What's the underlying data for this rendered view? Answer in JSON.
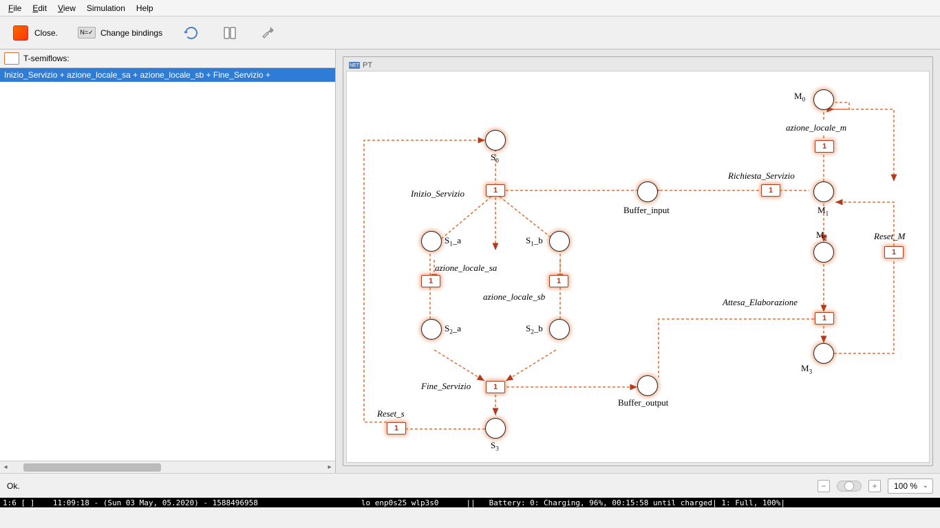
{
  "menubar": {
    "file": "File",
    "edit": "Edit",
    "view": "View",
    "simulation": "Simulation",
    "help": "Help"
  },
  "toolbar": {
    "close": "Close.",
    "change_bindings": "Change bindings"
  },
  "sidebar": {
    "title": "T-semiflows:",
    "item0": "Inizio_Servizio + azione_locale_sa + azione_locale_sb + Fine_Servizio +"
  },
  "canvas": {
    "title": "PT",
    "net_icon": "NET"
  },
  "net": {
    "t_val": "1",
    "places": {
      "S0": "S₀",
      "S1a": "S₁_a",
      "S1b": "S₁_b",
      "S2a": "S₂_a",
      "S2b": "S₂_b",
      "S3": "S₃",
      "buf_in": "Buffer_input",
      "buf_out": "Buffer_output",
      "M0": "M₀",
      "M1": "M₁",
      "M2": "M₂",
      "M3": "M₃"
    },
    "transitions": {
      "inizio": "Inizio_Servizio",
      "az_sa": "azione_locale_sa",
      "az_sb": "azione_locale_sb",
      "fine": "Fine_Servizio",
      "reset_s": "Reset_s",
      "az_m": "azione_locale_m",
      "richiesta": "Richiesta_Servizio",
      "reset_m": "Reset_M",
      "attesa": "Attesa_Elaborazione"
    }
  },
  "statusbar": {
    "msg": "Ok.",
    "zoom": "100 %"
  },
  "sysbar": {
    "left": "1:6 [ ]    11:09:18 - (Sun 03 May, 05.2020) - 1588496958",
    "mid": "lo enp0s25 wlp3s0",
    "right": "||   Battery: 0: Charging, 96%, 00:15:58 until charged| 1: Full, 100%|"
  }
}
